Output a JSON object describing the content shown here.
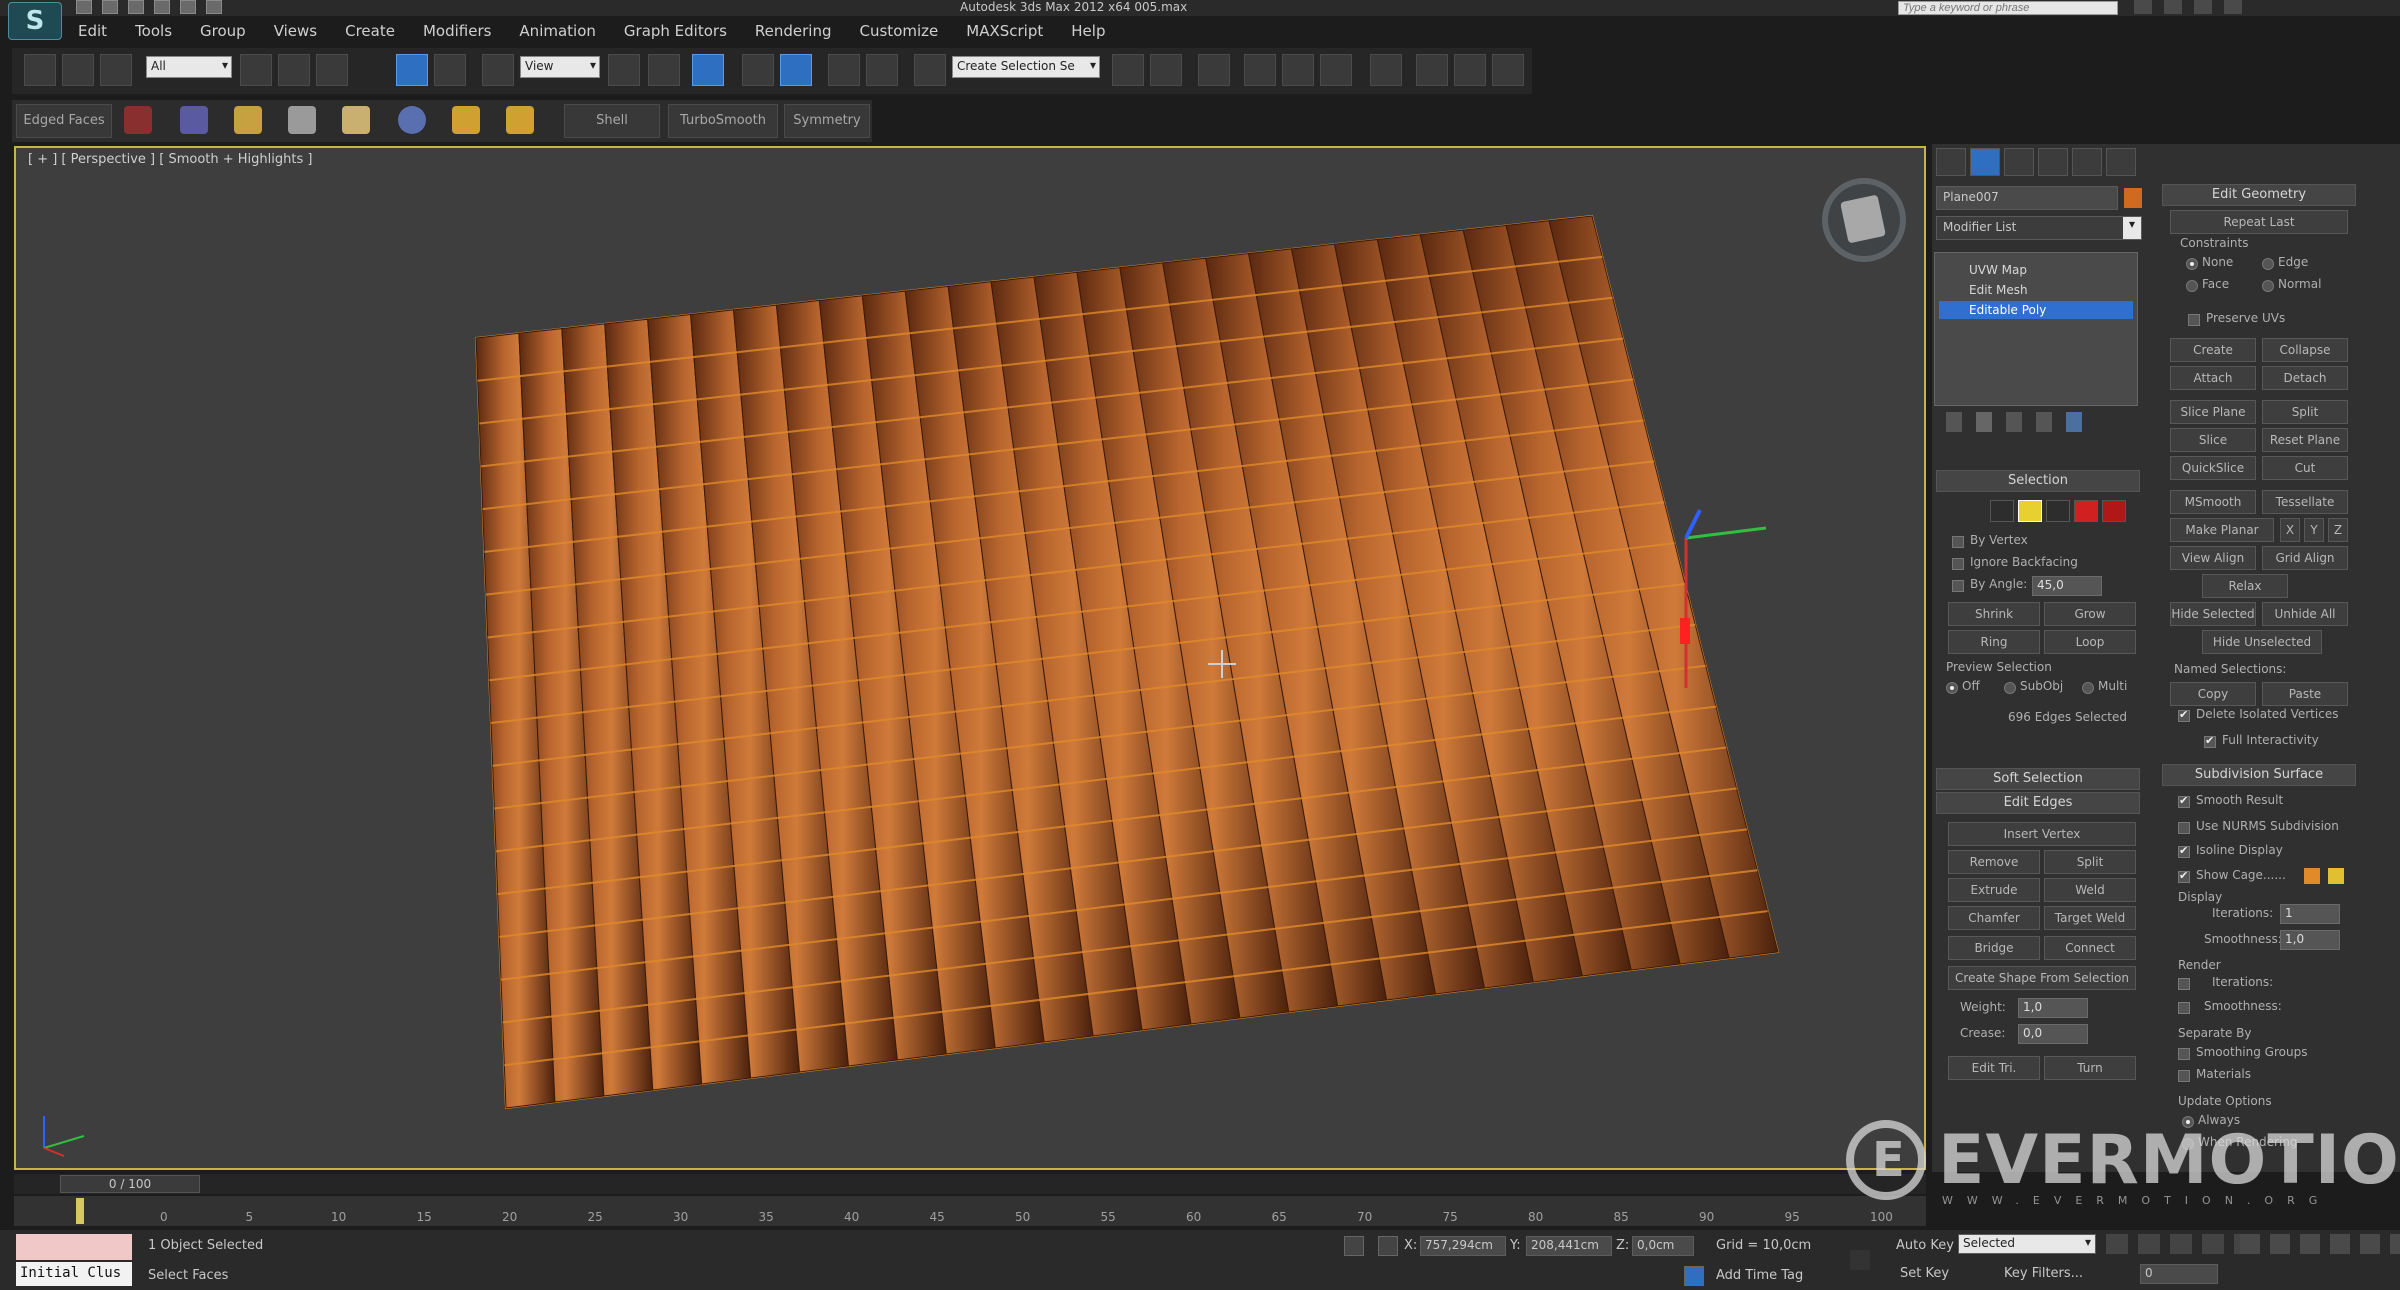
{
  "window": {
    "title": "Autodesk 3ds Max 2012 x64     005.max",
    "search_placeholder": "Type a keyword or phrase"
  },
  "menu": [
    "Edit",
    "Tools",
    "Group",
    "Views",
    "Create",
    "Modifiers",
    "Animation",
    "Graph Editors",
    "Rendering",
    "Customize",
    "MAXScript",
    "Help"
  ],
  "toolbar": {
    "filter_value": "All",
    "ref_coord_value": "View",
    "selection_set_value": "Create Selection Se"
  },
  "ribbon": {
    "edged_faces": "Edged Faces",
    "shell": "Shell",
    "turbosmooth": "TurboSmooth",
    "symmetry": "Symmetry"
  },
  "viewport": {
    "label": "[ + ] [ Perspective ] [ Smooth + Highlights ]"
  },
  "command_panel": {
    "object_name": "Plane007",
    "modifier_list": "Modifier List",
    "stack": [
      "UVW Map",
      "Edit Mesh",
      "Editable Poly"
    ],
    "selection": {
      "title": "Selection",
      "by_vertex": "By Vertex",
      "ignore_backfacing": "Ignore Backfacing",
      "by_angle": "By Angle:",
      "angle_value": "45,0",
      "shrink": "Shrink",
      "grow": "Grow",
      "ring": "Ring",
      "loop": "Loop",
      "preview_selection": "Preview Selection",
      "off": "Off",
      "subobj": "SubObj",
      "multi": "Multi",
      "status": "696 Edges Selected"
    },
    "soft_selection": "Soft Selection",
    "edit_edges": {
      "title": "Edit Edges",
      "insert_vertex": "Insert Vertex",
      "remove": "Remove",
      "split": "Split",
      "extrude": "Extrude",
      "weld": "Weld",
      "chamfer": "Chamfer",
      "target_weld": "Target Weld",
      "bridge": "Bridge",
      "connect": "Connect",
      "create_shape": "Create Shape From Selection",
      "weight_label": "Weight:",
      "weight_value": "1,0",
      "crease_label": "Crease:",
      "crease_value": "0,0",
      "edit_tri": "Edit Tri.",
      "turn": "Turn"
    },
    "edit_geometry": {
      "title": "Edit Geometry",
      "repeat_last": "Repeat Last",
      "constraints": "Constraints",
      "none": "None",
      "edge": "Edge",
      "face": "Face",
      "normal": "Normal",
      "preserve_uvs": "Preserve UVs",
      "create": "Create",
      "collapse": "Collapse",
      "attach": "Attach",
      "detach": "Detach",
      "slice_plane": "Slice Plane",
      "split": "Split",
      "slice": "Slice",
      "reset_plane": "Reset Plane",
      "quickslice": "QuickSlice",
      "cut": "Cut",
      "msmooth": "MSmooth",
      "tessellate": "Tessellate",
      "make_planar": "Make Planar",
      "x": "X",
      "y": "Y",
      "z": "Z",
      "view_align": "View Align",
      "grid_align": "Grid Align",
      "relax": "Relax",
      "hide_selected": "Hide Selected",
      "unhide_all": "Unhide All",
      "hide_unselected": "Hide Unselected",
      "named_selections": "Named Selections:",
      "copy": "Copy",
      "paste": "Paste",
      "delete_isolated": "Delete Isolated Vertices",
      "full_interactivity": "Full Interactivity"
    },
    "subdivision": {
      "title": "Subdivision Surface",
      "smooth_result": "Smooth Result",
      "use_nurms": "Use NURMS Subdivision",
      "isoline_display": "Isoline Display",
      "show_cage": "Show Cage......",
      "display": "Display",
      "iterations": "Iterations:",
      "iterations_value": "1",
      "smoothness": "Smoothness:",
      "smoothness_value": "1,0",
      "render": "Render",
      "separate_by": "Separate By",
      "smoothing_groups": "Smoothing Groups",
      "materials": "Materials",
      "update_options": "Update Options",
      "always": "Always",
      "when_rendering": "When Rendering"
    }
  },
  "timeline": {
    "position": "0 / 100",
    "ticks": [
      "0",
      "5",
      "10",
      "15",
      "20",
      "25",
      "30",
      "35",
      "40",
      "45",
      "50",
      "55",
      "60",
      "65",
      "70",
      "75",
      "80",
      "85",
      "90",
      "95",
      "100"
    ]
  },
  "status": {
    "listener": "Initial Clus",
    "selection_info": "1 Object Selected",
    "prompt": "Select Faces",
    "x_label": "X:",
    "x_value": "757,294cm",
    "y_label": "Y:",
    "y_value": "208,441cm",
    "z_label": "Z:",
    "z_value": "0,0cm",
    "grid": "Grid = 10,0cm",
    "add_time_tag": "Add Time Tag",
    "auto_key": "Auto Key",
    "set_key": "Set Key",
    "key_mode_value": "Selected",
    "key_filters": "Key Filters...",
    "frame_value": "0"
  },
  "watermark": {
    "text": "EVERMOTION",
    "url": "WWW.EVERMOTION.ORG"
  },
  "colors": {
    "tile": "#a9572a",
    "tile_edge": "#e08a2a",
    "viewport_bg": "#3e3e3e",
    "active_border": "#c9b44a",
    "selection_blue": "#2f6fd0"
  }
}
